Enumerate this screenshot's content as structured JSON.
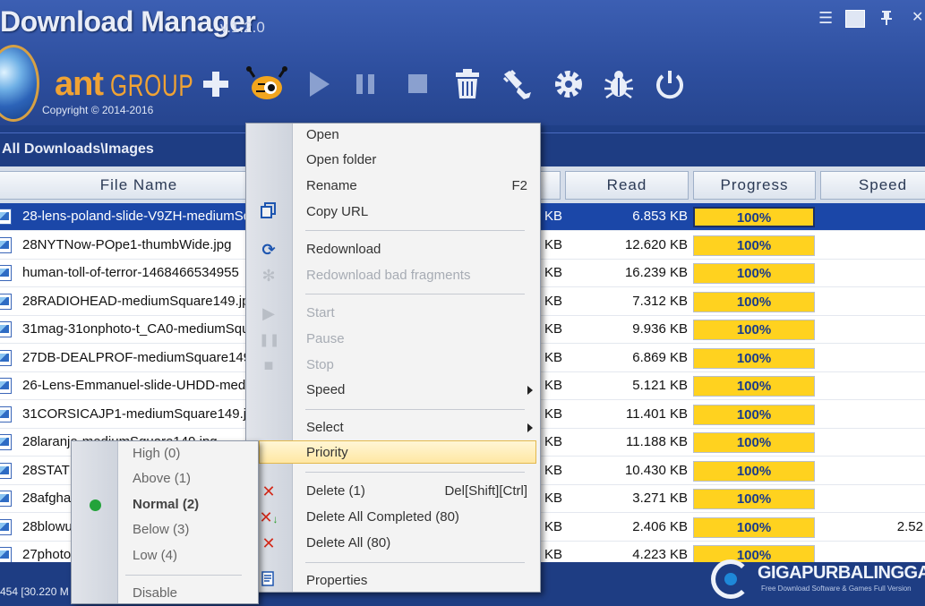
{
  "app": {
    "title": "Download Manager",
    "version": "v.1.2.0",
    "brand": "ant",
    "brand_group": "GROUP",
    "copyright": "Copyright © 2014-2016"
  },
  "window_controls": [
    {
      "name": "menu-icon",
      "glyph": "☰"
    },
    {
      "name": "layout-icon",
      "glyph": "▦"
    },
    {
      "name": "pin-icon",
      "glyph": "⊥"
    },
    {
      "name": "close-icon",
      "glyph": "✕"
    }
  ],
  "toolbar": [
    {
      "name": "add-download-icon"
    },
    {
      "name": "ant-mascot-icon"
    },
    {
      "name": "play-icon"
    },
    {
      "name": "pause-icon"
    },
    {
      "name": "stop-icon"
    },
    {
      "name": "trash-icon"
    },
    {
      "name": "plugin-icon"
    },
    {
      "name": "settings-gear-icon"
    },
    {
      "name": "bug-icon"
    },
    {
      "name": "power-icon"
    }
  ],
  "path": "All Downloads\\Images",
  "columns": {
    "file_name": "File Name",
    "read": "Read",
    "progress": "Progress",
    "speed": "Speed"
  },
  "rows": [
    {
      "name": "28-lens-poland-slide-V9ZH-mediumSquare149.jpg",
      "size": "KB",
      "read": "6.853 KB",
      "progress": "100%",
      "speed": "",
      "selected": true
    },
    {
      "name": "28NYTNow-POpe1-thumbWide.jpg",
      "size": "KB",
      "read": "12.620 KB",
      "progress": "100%",
      "speed": ""
    },
    {
      "name": "human-toll-of-terror-1468466534955",
      "size": "KB",
      "read": "16.239 KB",
      "progress": "100%",
      "speed": ""
    },
    {
      "name": "28RADIOHEAD-mediumSquare149.jpg",
      "size": "KB",
      "read": "7.312 KB",
      "progress": "100%",
      "speed": ""
    },
    {
      "name": "31mag-31onphoto-t_CA0-mediumSquare",
      "size": "KB",
      "read": "9.936 KB",
      "progress": "100%",
      "speed": ""
    },
    {
      "name": "27DB-DEALPROF-mediumSquare149.jpg",
      "size": "KB",
      "read": "6.869 KB",
      "progress": "100%",
      "speed": ""
    },
    {
      "name": "26-Lens-Emmanuel-slide-UHDD-mediumSquare",
      "size": "KB",
      "read": "5.121 KB",
      "progress": "100%",
      "speed": ""
    },
    {
      "name": "31CORSICAJP1-mediumSquare149.jpg",
      "size": "KB",
      "read": "11.401 KB",
      "progress": "100%",
      "speed": ""
    },
    {
      "name": "28laranjo-mediumSquare149.jpg",
      "size": "KB",
      "read": "11.188 KB",
      "progress": "100%",
      "speed": ""
    },
    {
      "name": "28STATE-mediumSquare149.jpg",
      "size": "KB",
      "read": "10.430 KB",
      "progress": "100%",
      "speed": ""
    },
    {
      "name": "28afghanistan-mediumSquare149.jpg",
      "size": "KB",
      "read": "3.271 KB",
      "progress": "100%",
      "speed": ""
    },
    {
      "name": "28blowup-mediumSquare149.jpg",
      "size": "KB",
      "read": "2.406 KB",
      "progress": "100%",
      "speed": "2.52"
    },
    {
      "name": "27photo-mediumSquare149.jpg",
      "size": "KB",
      "read": "4.223 KB",
      "progress": "100%",
      "speed": ""
    }
  ],
  "progress_fraction": 1.0,
  "status": "454 [30.220 M",
  "watermark": {
    "text": "GIGAPURBALINGGA",
    "sub": "Free Download Software & Games Full Version"
  },
  "context_menu": {
    "open": "Open",
    "open_folder": "Open folder",
    "rename": "Rename",
    "rename_shortcut": "F2",
    "copy_url": "Copy URL",
    "redownload": "Redownload",
    "redownload_bad": "Redownload bad fragments",
    "start": "Start",
    "pause": "Pause",
    "stop": "Stop",
    "speed": "Speed",
    "select": "Select",
    "priority": "Priority",
    "delete": "Delete (1)",
    "delete_shortcut": "Del[Shift][Ctrl]",
    "delete_completed": "Delete All Completed (80)",
    "delete_all": "Delete All (80)",
    "properties": "Properties"
  },
  "priority_menu": {
    "high": "High (0)",
    "above": "Above (1)",
    "normal": "Normal (2)",
    "below": "Below (3)",
    "low": "Low (4)",
    "disable": "Disable"
  },
  "colors": {
    "accent": "#1f3f86",
    "selection": "#1b47a8",
    "progress": "#ffd21f",
    "brand": "#f0a334"
  }
}
